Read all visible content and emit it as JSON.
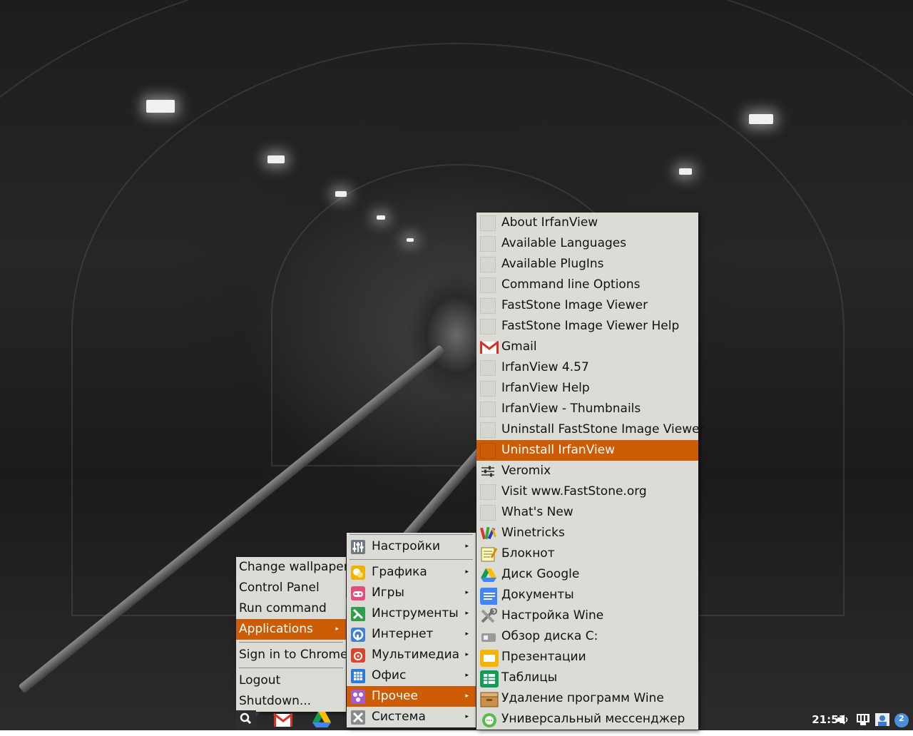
{
  "root_menu": {
    "items": [
      {
        "label": "Change wallpaper"
      },
      {
        "label": "Control Panel"
      },
      {
        "label": "Run command"
      },
      {
        "label": "Applications",
        "arrow": "▸"
      },
      {
        "label": "Sign in to Chrome"
      },
      {
        "label": "Logout"
      },
      {
        "label": "Shutdown..."
      }
    ]
  },
  "apps_menu": {
    "items": [
      {
        "label": "Настройки",
        "icon": "settings-icon",
        "arrow": "▸"
      },
      {
        "label": "Графика",
        "icon": "graphics-icon",
        "arrow": "▸"
      },
      {
        "label": "Игры",
        "icon": "gamepad-icon",
        "arrow": "▸"
      },
      {
        "label": "Инструменты",
        "icon": "tools-icon",
        "arrow": "▸"
      },
      {
        "label": "Интернет",
        "icon": "internet-icon",
        "arrow": "▸"
      },
      {
        "label": "Мультимедиа",
        "icon": "multimedia-icon",
        "arrow": "▸"
      },
      {
        "label": "Офис",
        "icon": "office-icon",
        "arrow": "▸"
      },
      {
        "label": "Прочее",
        "icon": "other-icon",
        "arrow": "▸"
      },
      {
        "label": "Система",
        "icon": "system-icon",
        "arrow": "▸"
      }
    ]
  },
  "other_menu": {
    "items": [
      {
        "label": "About IrfanView",
        "icon": "blank-icon"
      },
      {
        "label": "Available Languages",
        "icon": "blank-icon"
      },
      {
        "label": "Available PlugIns",
        "icon": "blank-icon"
      },
      {
        "label": "Command line Options",
        "icon": "blank-icon"
      },
      {
        "label": "FastStone Image Viewer",
        "icon": "blank-icon"
      },
      {
        "label": "FastStone Image Viewer Help",
        "icon": "blank-icon"
      },
      {
        "label": "Gmail",
        "icon": "gmail-icon"
      },
      {
        "label": "IrfanView 4.57",
        "icon": "blank-icon"
      },
      {
        "label": "IrfanView Help",
        "icon": "blank-icon"
      },
      {
        "label": "IrfanView - Thumbnails",
        "icon": "blank-icon"
      },
      {
        "label": "Uninstall FastStone Image Viewer",
        "icon": "blank-icon"
      },
      {
        "label": "Uninstall IrfanView",
        "icon": "blank-icon"
      },
      {
        "label": "Veromix",
        "icon": "mixer-icon"
      },
      {
        "label": "Visit www.FastStone.org",
        "icon": "blank-icon"
      },
      {
        "label": "What's New",
        "icon": "blank-icon"
      },
      {
        "label": "Winetricks",
        "icon": "winetricks-icon"
      },
      {
        "label": "Блокнот",
        "icon": "notepad-icon"
      },
      {
        "label": "Диск Google",
        "icon": "google-drive-icon"
      },
      {
        "label": "Документы",
        "icon": "google-docs-icon"
      },
      {
        "label": "Настройка Wine",
        "icon": "wine-config-icon"
      },
      {
        "label": "Обзор диска C:",
        "icon": "drive-icon"
      },
      {
        "label": "Презентации",
        "icon": "google-slides-icon"
      },
      {
        "label": "Таблицы",
        "icon": "google-sheets-icon"
      },
      {
        "label": "Удаление программ Wine",
        "icon": "uninstall-icon"
      },
      {
        "label": "Универсальный мессенджер",
        "icon": "messenger-icon"
      }
    ]
  },
  "taskbar": {
    "clock": "21:51",
    "notification_count": "2"
  },
  "colors": {
    "menu_bg": "#dcdcd6",
    "highlight": "#cc5d06"
  }
}
